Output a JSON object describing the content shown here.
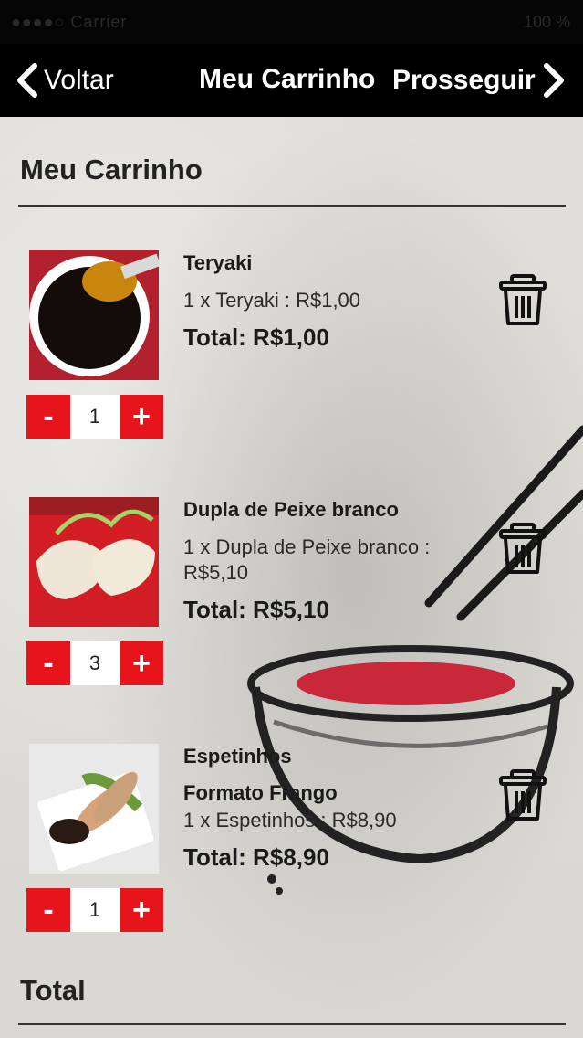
{
  "status_bar": {
    "carrier": "●●●●○ Carrier",
    "battery": "100 %"
  },
  "nav": {
    "back_label": "Voltar",
    "title": "Meu Carrinho",
    "next_label": "Prosseguir"
  },
  "cart_title": "Meu Carrinho",
  "items": [
    {
      "name": "Teryaki",
      "option": "",
      "detail": "1 x Teryaki : R$1,00",
      "total": "Total: R$1,00",
      "quantity": "1",
      "minus": "-",
      "plus": "+"
    },
    {
      "name": "Dupla de Peixe branco",
      "option": "",
      "detail": "1 x Dupla de Peixe branco : R$5,10",
      "total": "Total: R$5,10",
      "quantity": "3",
      "minus": "-",
      "plus": "+"
    },
    {
      "name": "Espetinhos",
      "option": "Formato Frango",
      "detail": "1 x Espetinhos : R$8,90",
      "total": "Total: R$8,90",
      "quantity": "1",
      "minus": "-",
      "plus": "+"
    }
  ],
  "total_title": "Total",
  "colors": {
    "nav_bg": "#000000",
    "stepper_red": "#e8141c",
    "paper_bg": "#dcdad4"
  }
}
